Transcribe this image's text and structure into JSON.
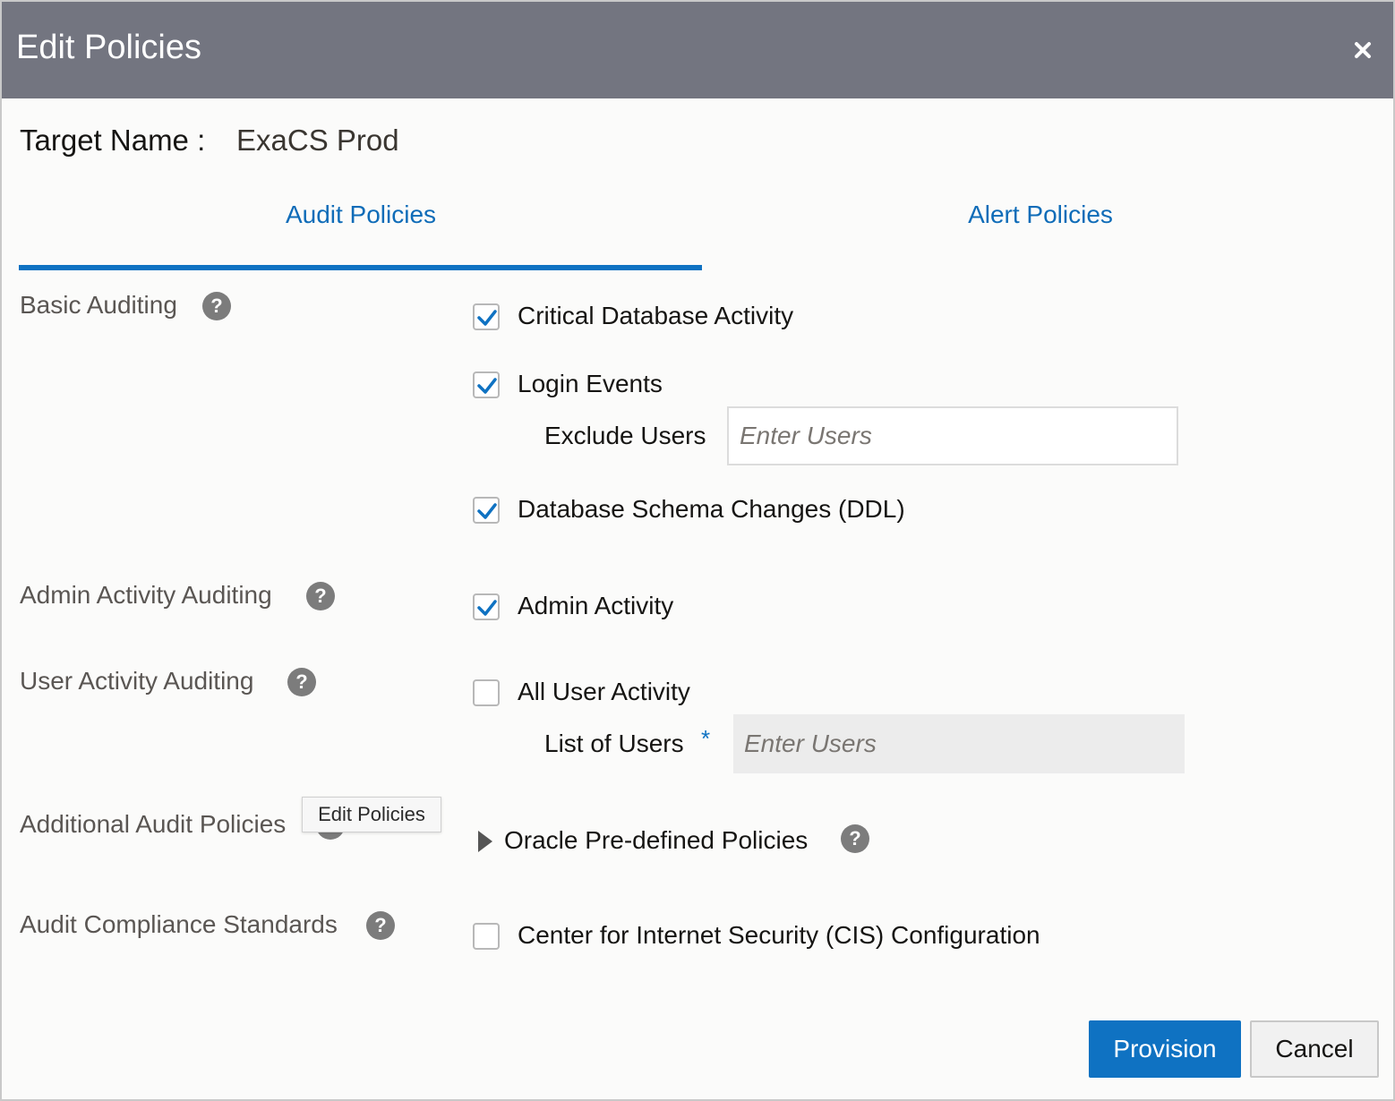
{
  "dialog": {
    "title": "Edit Policies",
    "close_icon": "close-icon"
  },
  "target": {
    "label": "Target Name :",
    "value": "ExaCS Prod"
  },
  "tabs": [
    {
      "label": "Audit Policies",
      "selected": true
    },
    {
      "label": "Alert Policies",
      "selected": false
    }
  ],
  "sections": {
    "basic": {
      "label": "Basic Auditing",
      "options": [
        {
          "label": "Critical Database Activity",
          "checked": true
        },
        {
          "label": "Login Events",
          "checked": true
        },
        {
          "label": "Database Schema Changes (DDL)",
          "checked": true
        }
      ],
      "exclude_users": {
        "label": "Exclude Users",
        "placeholder": "Enter Users"
      }
    },
    "admin": {
      "label": "Admin Activity Auditing",
      "options": [
        {
          "label": "Admin Activity",
          "checked": true
        }
      ]
    },
    "user": {
      "label": "User Activity Auditing",
      "options": [
        {
          "label": "All User Activity",
          "checked": false
        }
      ],
      "list_of_users": {
        "label": "List of Users",
        "required_mark": "*",
        "placeholder": "Enter Users"
      }
    },
    "additional": {
      "label": "Additional Audit Policies",
      "tooltip": "Edit Policies",
      "expander_label": "Oracle Pre-defined Policies"
    },
    "compliance": {
      "label": "Audit Compliance Standards",
      "options": [
        {
          "label": "Center for Internet Security (CIS) Configuration",
          "checked": false
        }
      ]
    }
  },
  "help_icon_glyph": "?",
  "buttons": {
    "provision": "Provision",
    "cancel": "Cancel"
  },
  "colors": {
    "accent": "#0f72c2",
    "titlebar": "#737580"
  }
}
